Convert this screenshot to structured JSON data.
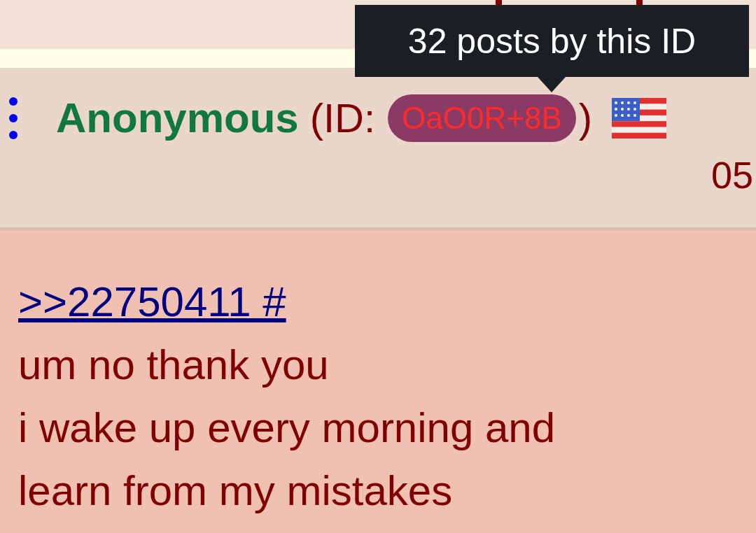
{
  "tooltip": {
    "text": "32 posts by this ID"
  },
  "post": {
    "name": "Anonymous",
    "id_prefix": "(ID:",
    "id": "OaO0R+8B",
    "id_suffix": ")",
    "time": "05",
    "quote_link": ">>22750411 #",
    "lines": [
      "um no thank you",
      "i wake up every morning and",
      "learn from my mistakes"
    ]
  }
}
